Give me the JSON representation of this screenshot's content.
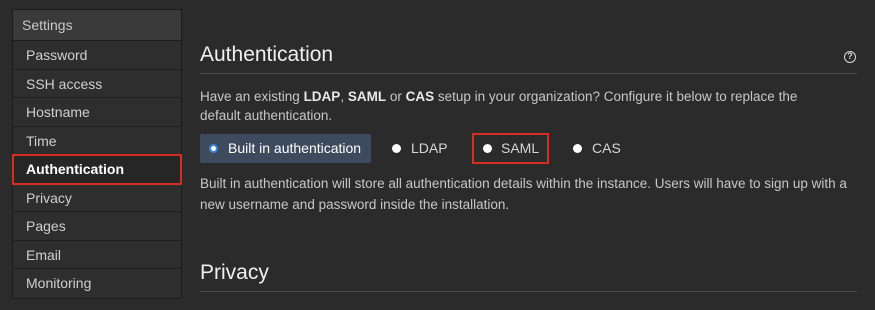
{
  "sidebar": {
    "header": "Settings",
    "items": [
      {
        "label": "Password"
      },
      {
        "label": "SSH access"
      },
      {
        "label": "Hostname"
      },
      {
        "label": "Time"
      },
      {
        "label": "Authentication"
      },
      {
        "label": "Privacy"
      },
      {
        "label": "Pages"
      },
      {
        "label": "Email"
      },
      {
        "label": "Monitoring"
      }
    ],
    "active": "Authentication"
  },
  "authentication": {
    "title": "Authentication",
    "help_icon": "question-circle-icon",
    "intro": {
      "p1": "Have an existing ",
      "ldap": "LDAP",
      "p2": ", ",
      "saml": "SAML",
      "p3": " or ",
      "cas": "CAS",
      "p4": " setup in your organization? Configure it below to replace the default authentication."
    },
    "options": [
      {
        "label": "Built in authentication",
        "selected": true
      },
      {
        "label": "LDAP",
        "selected": false
      },
      {
        "label": "SAML",
        "selected": false
      },
      {
        "label": "CAS",
        "selected": false
      }
    ],
    "description": "Built in authentication will store all authentication details within the instance. Users will have to sign up with a new username and password inside the installation."
  },
  "privacy": {
    "title": "Privacy"
  },
  "colors": {
    "background": "#2b2b2b",
    "highlight": "#d42e20",
    "selected_bg": "#3e4b5e",
    "radio_accent": "#3d85d8"
  }
}
